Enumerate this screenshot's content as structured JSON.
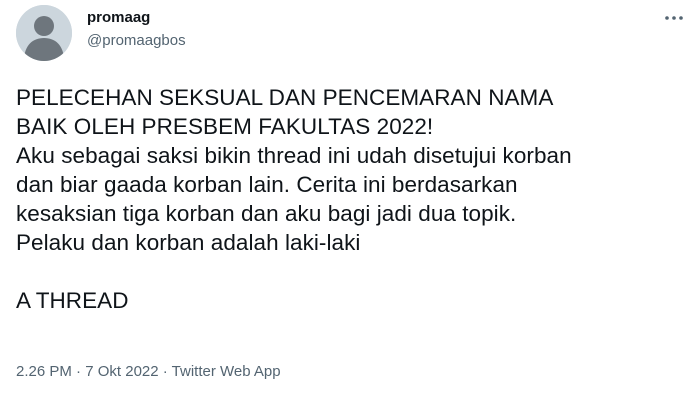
{
  "author": {
    "display_name": "promaag",
    "handle": "@promaagbos",
    "avatar_icon": "default-avatar-icon"
  },
  "menu": {
    "icon": "more-horizontal-icon"
  },
  "tweet": {
    "lines": [
      "PELECEHAN SEKSUAL DAN PENCEMARAN NAMA",
      "BAIK OLEH PRESBEM FAKULTAS 2022!",
      "Aku sebagai saksi bikin thread ini udah disetujui korban",
      "dan biar gaada korban lain. Cerita ini berdasarkan",
      "kesaksian tiga korban dan aku bagi jadi dua topik.",
      "Pelaku dan korban adalah laki-laki"
    ],
    "footer_line": "A THREAD"
  },
  "meta": {
    "time": "2.26 PM",
    "separator": " · ",
    "date": "7 Okt 2022",
    "source": "Twitter Web App"
  },
  "colors": {
    "text": "#0f1419",
    "secondary": "#536471",
    "avatar_bg": "#ccd6dd",
    "avatar_fg": "#6e767d"
  }
}
